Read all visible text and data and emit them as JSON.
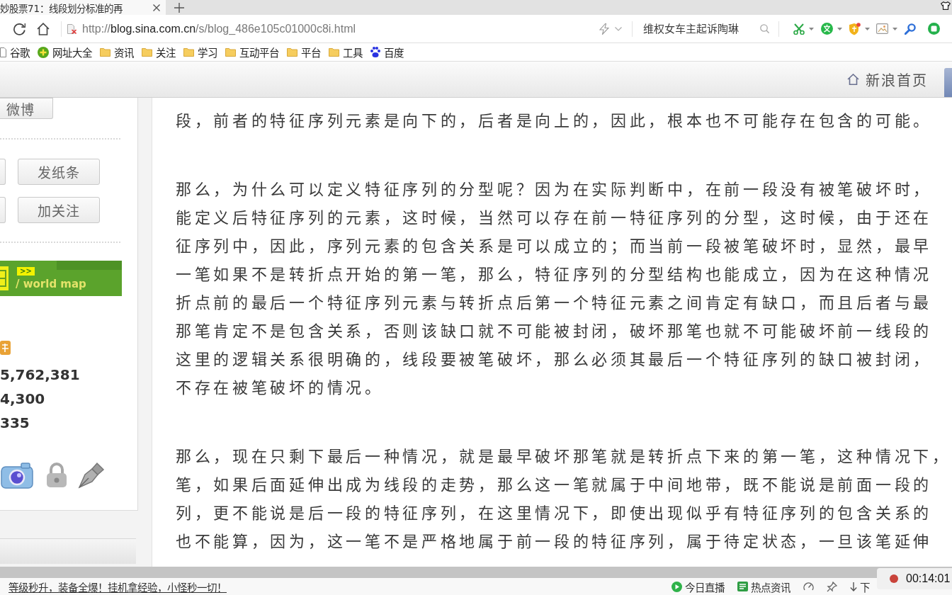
{
  "browser_tab": {
    "title": "妙股票71：线段划分标准的再",
    "selected": true
  },
  "address_bar": {
    "url": {
      "scheme": "http://",
      "host": "blog.sina.com.cn",
      "path": "/s/blog_486e105c01000c8i.html"
    },
    "search": {
      "placeholder": "维权女车主起诉陶琳"
    }
  },
  "bookmarks": [
    {
      "label": "谷歌",
      "kind": "page"
    },
    {
      "label": "网址大全",
      "kind": "site"
    },
    {
      "label": "资讯",
      "kind": "folder"
    },
    {
      "label": "关注",
      "kind": "folder"
    },
    {
      "label": "学习",
      "kind": "folder"
    },
    {
      "label": "互动平台",
      "kind": "folder"
    },
    {
      "label": "平台",
      "kind": "folder"
    },
    {
      "label": "工具",
      "kind": "folder"
    },
    {
      "label": "百度",
      "kind": "paw"
    }
  ],
  "site_header": {
    "home_link": "新浪首页"
  },
  "sidebar": {
    "weibo_button": "微博",
    "action_buttons": [
      "发纸条",
      "加关注"
    ],
    "map_banner": {
      "arrows": ">>",
      "label": "/ world map"
    },
    "stats": [
      "5,762,381",
      "4,300",
      "335"
    ]
  },
  "article": {
    "paragraphs": [
      {
        "lines": [
          "段，前者的特征序列元素是向下的，后者是向上的，因此，根本也不可能存在包含的可能。"
        ]
      },
      {
        "lines": [
          "那么，为什么可以定义特征序列的分型呢？因为在实际判断中，在前一段没有被笔破坏时，",
          "能定义后特征序列的元素，这时候，当然可以存在前一特征序列的分型，这时候，由于还在",
          "征序列中，因此，序列元素的包含关系是可以成立的；而当前一段被笔破坏时，显然，最早",
          "一笔如果不是转折点开始的第一笔，那么，特征序列的分型结构也能成立，因为在这种情况",
          "折点前的最后一个特征序列元素与转折点后第一个特征元素之间肯定有缺口，而且后者与最",
          "那笔肯定不是包含关系，否则该缺口就不可能被封闭，破坏那笔也就不可能破坏前一线段的",
          "这里的逻辑关系很明确的，线段要被笔破坏，那么必须其最后一个特征序列的缺口被封闭，",
          "不存在被笔破坏的情况。"
        ]
      },
      {
        "lines": [
          "那么，现在只剩下最后一种情况，就是最早破坏那笔就是转折点下来的第一笔，这种情况下，",
          "笔，如果后面延伸出成为线段的走势，那么这一笔就属于中间地带，既不能说是前面一段的",
          "列，更不能说是后一段的特征序列，在这里情况下，即使出现似乎有特征序列的包含关系的",
          "也不能算，因为，这一笔不是严格地属于前一段的特征序列，属于待定状态，一旦该笔延伸"
        ]
      }
    ]
  },
  "status_bar": {
    "ad_text": "等级秒升，装备全爆！挂机拿经验，小怪秒一切！",
    "items": [
      {
        "label": "今日直播",
        "kind": "live"
      },
      {
        "label": "热点资讯",
        "kind": "news"
      }
    ],
    "download_label": "下"
  },
  "recorder": {
    "time": "00:14:01"
  }
}
